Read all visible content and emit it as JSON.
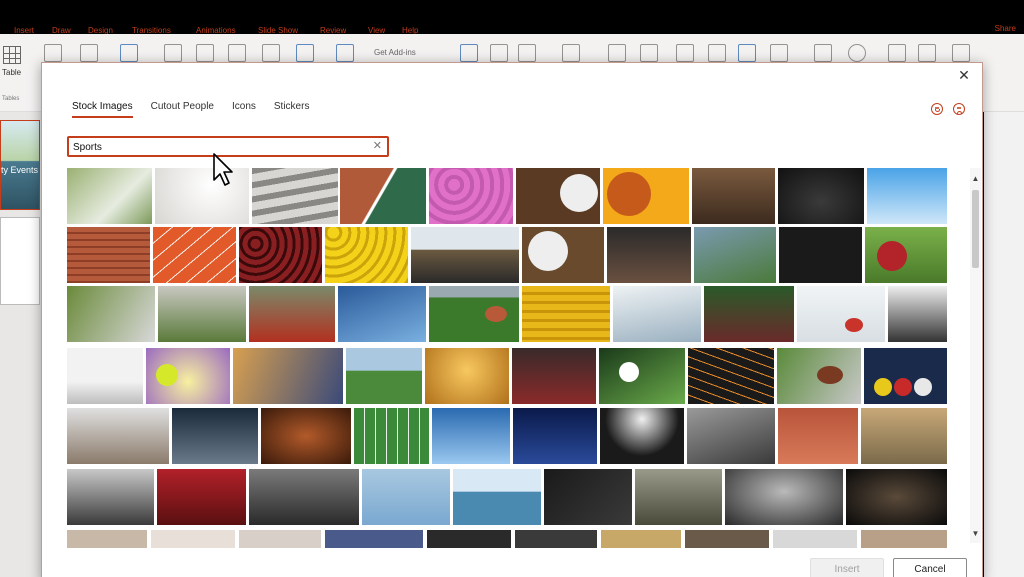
{
  "app": {
    "ribbon_tabs": [
      "Insert",
      "Draw",
      "Design",
      "Transitions",
      "Animations",
      "Slide Show",
      "Review",
      "View",
      "Help"
    ],
    "share_label": "Share",
    "table_button_label": "Table",
    "tables_group_label": "Tables",
    "get_addins_label": "Get Add-ins",
    "slide_title_text": "ty Events"
  },
  "dialog": {
    "tabs": [
      {
        "label": "Stock Images",
        "active": true
      },
      {
        "label": "Cutout People",
        "active": false
      },
      {
        "label": "Icons",
        "active": false
      },
      {
        "label": "Stickers",
        "active": false
      }
    ],
    "search_value": "Sports",
    "search_clear_icon": "close-icon",
    "insert_label": "Insert",
    "cancel_label": "Cancel",
    "close_icon": "close-icon",
    "feedback_icons": [
      "smile-icon",
      "frown-icon"
    ]
  },
  "images": [
    [
      "tennis net and ball",
      "baseball on white",
      "baseball bats",
      "court lines",
      "pink balls pattern",
      "baseball on wood",
      "basketball on yellow",
      "football player holding ball",
      "basketball court",
      "basketball hoop"
    ],
    [
      "surfboards on wall",
      "running track",
      "cricket balls",
      "tennis balls",
      "rowing team",
      "baseball and glove",
      "gymnast on bar",
      "rugby players",
      "fencing match",
      "cricket ball and bat"
    ],
    [
      "baseball batter",
      "hockey team",
      "football huddle",
      "tennis player serving",
      "football on field",
      "stadium seats",
      "ice rink",
      "soccer players",
      "curling stones",
      "football team"
    ],
    [
      "sprinter silhouette",
      "tennis ball on court",
      "football players running",
      "soccer game",
      "dust race",
      "team huddle",
      "soccer ball in net",
      "running track lanes",
      "rugby ball in hand",
      "pool billiard balls"
    ],
    [
      "horse racing",
      "ice hockey",
      "american football",
      "football field aerial",
      "basketball hoop blue sky",
      "goal post night",
      "soccer player stadium",
      "track aerial",
      "sprinters at start",
      "rugby tackle"
    ],
    [
      "running track at dusk",
      "soccer team celebrating",
      "runner tying shoes",
      "runners aerial",
      "surfer on wave",
      "rowers",
      "football team players",
      "soccer player kicking",
      "motocross dust"
    ]
  ],
  "colors": {
    "accent": "#c43e1c",
    "insert_disabled": "#a0a0a0"
  }
}
